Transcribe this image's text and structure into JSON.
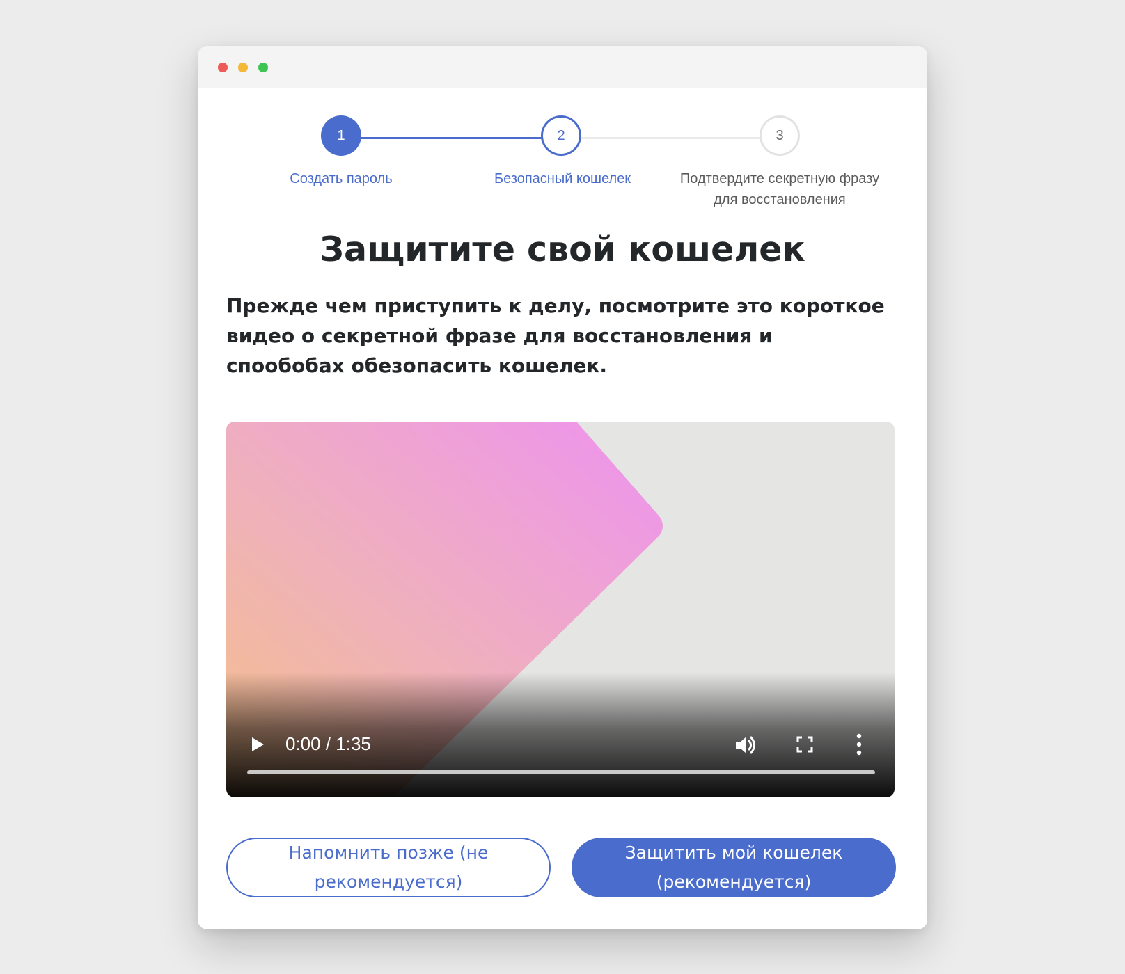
{
  "colors": {
    "accent": "#4a6ccc",
    "title_text": "#24272a",
    "pending_step": "#e2e2e2",
    "window_close": "#ee5a55",
    "window_minimize": "#f4b738",
    "window_maximize": "#3ec452"
  },
  "stepper": {
    "steps": [
      {
        "number": "1",
        "label": "Создать пароль",
        "state": "completed"
      },
      {
        "number": "2",
        "label": "Безопасный кошелек",
        "state": "current"
      },
      {
        "number": "3",
        "label": "Подтвердите секретную фразу для восстановления",
        "state": "pending"
      }
    ]
  },
  "main": {
    "title": "Защитите свой кошелек",
    "description": "Прежде чем приступить к делу, посмотрите это короткое видео о секретной фразе для восстановления и спообобах обезопасить кошелек."
  },
  "video": {
    "time": "0:00 / 1:35",
    "current_time": "0:00",
    "duration": "1:35",
    "progress": 0,
    "icons": {
      "play": "play-icon",
      "volume": "volume-icon",
      "fullscreen": "fullscreen-icon",
      "more": "more-vertical-icon"
    }
  },
  "actions": {
    "remind_later_label": "Напомнить позже (не рекомендуется)",
    "secure_wallet_label": "Защитить мой кошелек (рекомендуется)"
  }
}
